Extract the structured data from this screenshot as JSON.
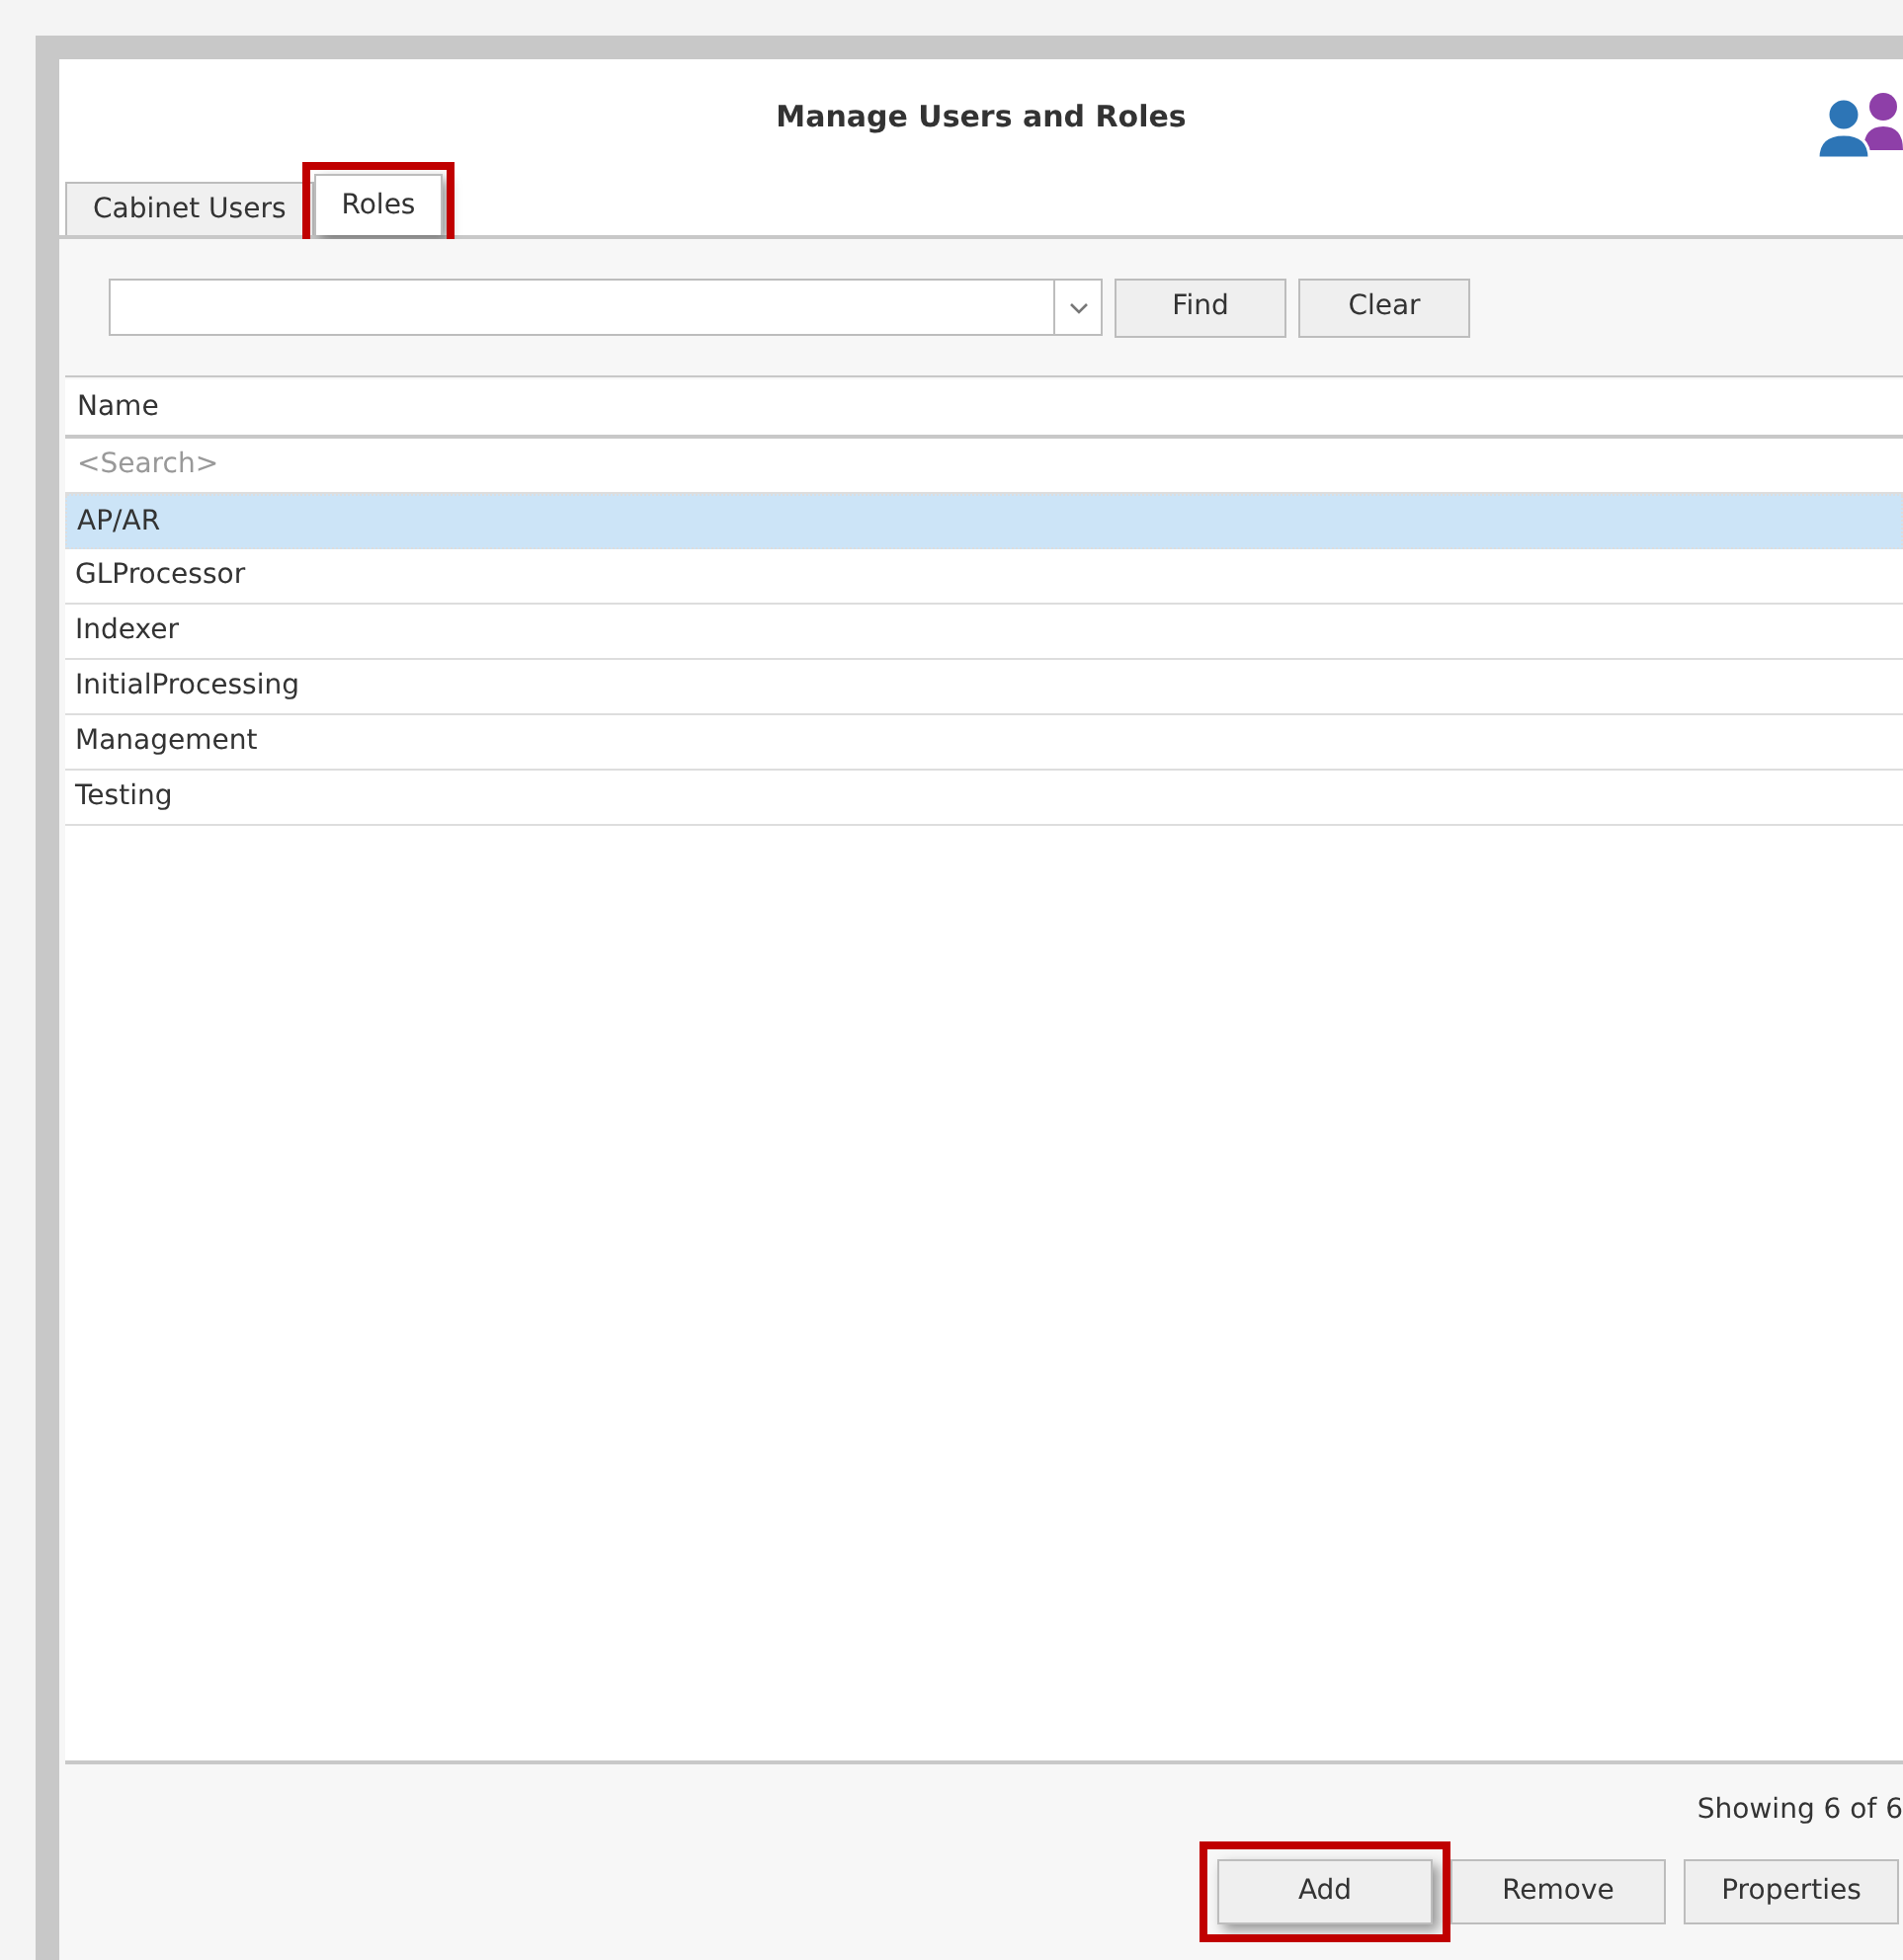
{
  "window": {
    "title": "Manage Users and Roles"
  },
  "tabs": [
    {
      "label": "Cabinet Users",
      "selected": false,
      "highlighted": false
    },
    {
      "label": "Roles",
      "selected": true,
      "highlighted": true
    }
  ],
  "search_bar": {
    "buttons": [
      "Find",
      "Clear"
    ]
  },
  "table": {
    "columns": [
      "Name"
    ],
    "search_placeholder": "<Search>",
    "rows": [
      {
        "name": "AP/AR",
        "selected": true
      },
      {
        "name": "GLProcessor",
        "selected": false
      },
      {
        "name": "Indexer",
        "selected": false
      },
      {
        "name": "InitialProcessing",
        "selected": false
      },
      {
        "name": "Management",
        "selected": false
      },
      {
        "name": "Testing",
        "selected": false
      }
    ]
  },
  "status": "Showing 6 of 6",
  "buttons": [
    {
      "label": "Add",
      "highlighted": true
    },
    {
      "label": "Remove",
      "highlighted": false
    },
    {
      "label": "Properties",
      "highlighted": false
    }
  ]
}
